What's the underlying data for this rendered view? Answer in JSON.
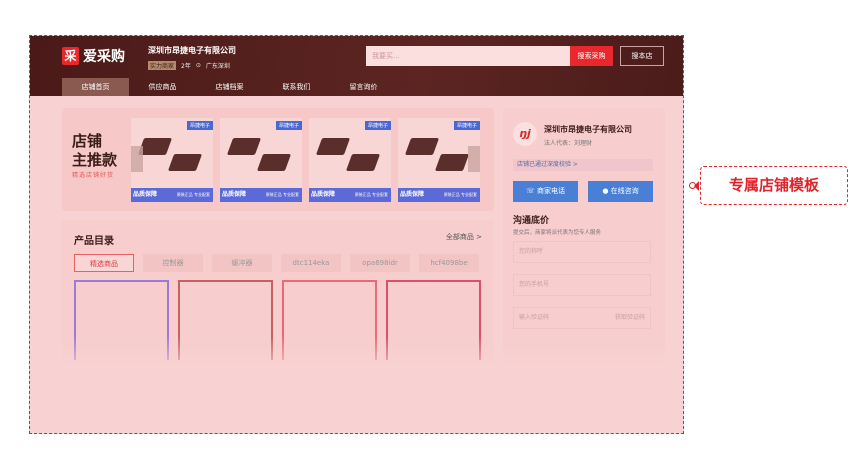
{
  "header": {
    "logo_mark": "采",
    "logo_text": "爱采购",
    "shop_name": "深圳市昂捷电子有限公司",
    "badge": "实力商家",
    "years": "2年",
    "location": "广东深圳",
    "search_placeholder": "我要买...",
    "search_button": "搜索采购",
    "store_button": "搜本店"
  },
  "nav": [
    "店铺首页",
    "供应商品",
    "店铺档案",
    "联系我们",
    "留言询价"
  ],
  "banner": {
    "title_line1": "店铺",
    "title_line2": "主推款",
    "subtitle": "精选店铺好货",
    "cards": [
      {
        "tag": "昂捷电子",
        "guarantee": "品质保障",
        "note": "原装正品 专业配套"
      },
      {
        "tag": "昂捷电子",
        "guarantee": "品质保障",
        "note": "原装正品 专业配套"
      },
      {
        "tag": "昂捷电子",
        "guarantee": "品质保障",
        "note": "原装正品 专业配套"
      },
      {
        "tag": "昂捷电子",
        "guarantee": "品质保障",
        "note": "原装正品 专业配套"
      }
    ]
  },
  "catalog": {
    "title": "产品目录",
    "all_link": "全部商品 >",
    "tabs": [
      "精选商品",
      "控制器",
      "缓冲器",
      "dtc114eka",
      "opa698idr",
      "hcf4098be"
    ]
  },
  "sidebar": {
    "avatar": "ŋj",
    "company": "深圳市昂捷电子有限公司",
    "legal_rep": "法人代表：刘理财",
    "verified": "店铺已通过深度校验 >",
    "phone_button": "商家电话",
    "chat_button": "在线咨询",
    "section_title": "沟通底价",
    "section_sub": "提交后，商家将派代表为您专人服务",
    "name_placeholder": "您的称呼",
    "phone_placeholder": "您的手机号",
    "code_placeholder": "输入验证码",
    "get_code": "获取验证码"
  },
  "callout": "专属店铺模板",
  "colors": {
    "accent": "#e0242b",
    "header": "#4a1a18",
    "button": "#4a7fd6"
  }
}
